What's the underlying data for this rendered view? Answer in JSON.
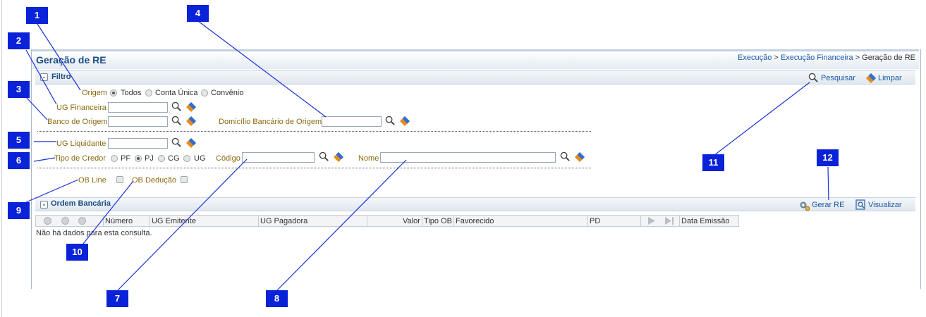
{
  "page": {
    "title": "Geração de RE"
  },
  "breadcrumb": {
    "part1": "Execução",
    "sep": ">",
    "part2": "Execução Financeira",
    "current": "Geração de RE"
  },
  "filter": {
    "section_title": "Filtro",
    "pesquisar": "Pesquisar",
    "limpar": "Limpar",
    "origem_label": "Origem",
    "origem_options": [
      "Todos",
      "Conta Única",
      "Convênio"
    ],
    "origem_selected": "Todos",
    "ug_financeira_label": "UG Financeira",
    "banco_origem_label": "Banco de Origem",
    "domicilio_label": "Domicílio Bancário de Origem",
    "ug_liquidante_label": "UG Liquidante",
    "tipo_credor_label": "Tipo de Credor",
    "tipo_credor_options": [
      "PF",
      "PJ",
      "CG",
      "UG"
    ],
    "tipo_credor_selected": "PJ",
    "codigo_label": "Código",
    "nome_label": "Nome",
    "ob_line_label": "OB Line",
    "ob_deducao_label": "OB Dedução"
  },
  "ordem": {
    "section_title": "Ordem Bancária",
    "gerar_re": "Gerar RE",
    "visualizar": "Visualizar",
    "columns": [
      "Número",
      "UG Emitente",
      "UG Pagadora",
      "Valor",
      "Tipo OB",
      "Favorecido",
      "PD",
      "Data Emissão"
    ],
    "empty_message": "Não há dados para esta consulta."
  },
  "callouts": [
    "1",
    "2",
    "3",
    "4",
    "5",
    "6",
    "7",
    "8",
    "9",
    "10",
    "11",
    "12"
  ],
  "colors": {
    "callout": "#0a22d8",
    "title": "#1c4d86",
    "label": "#8a6a12",
    "link": "#1c5aa6"
  }
}
